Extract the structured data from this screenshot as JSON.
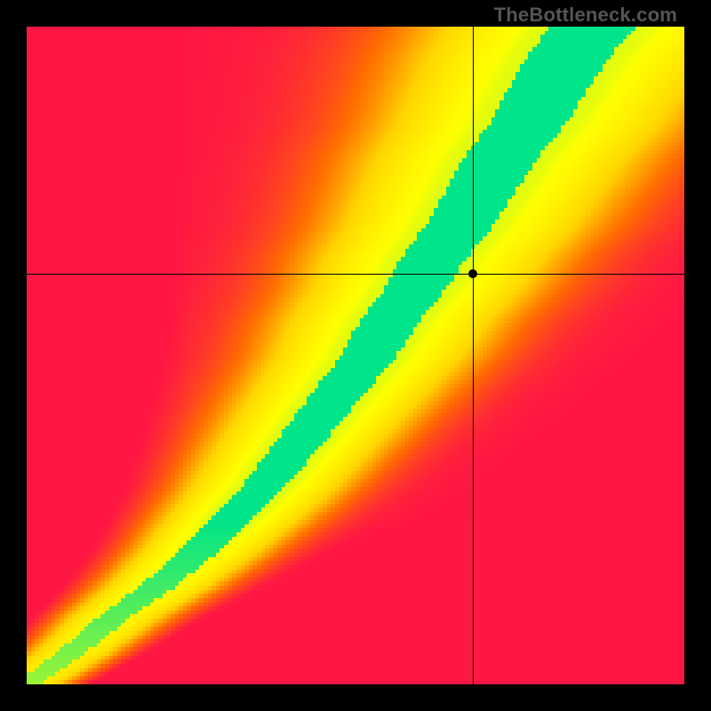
{
  "watermark": "TheBottleneck.com",
  "chart_data": {
    "type": "heatmap",
    "title": "",
    "xlabel": "",
    "ylabel": "",
    "xlim": [
      0,
      1
    ],
    "ylim": [
      0,
      1
    ],
    "grid": false,
    "legend": false,
    "crosshair": {
      "x": 0.678,
      "y": 0.625
    },
    "marker": {
      "x": 0.678,
      "y": 0.625
    },
    "green_ridge_x_for_y": [
      [
        0.0,
        0.0
      ],
      [
        0.05,
        0.07
      ],
      [
        0.1,
        0.13
      ],
      [
        0.15,
        0.2
      ],
      [
        0.2,
        0.26
      ],
      [
        0.25,
        0.31
      ],
      [
        0.3,
        0.36
      ],
      [
        0.35,
        0.4
      ],
      [
        0.4,
        0.44
      ],
      [
        0.45,
        0.48
      ],
      [
        0.5,
        0.52
      ],
      [
        0.55,
        0.55
      ],
      [
        0.6,
        0.59
      ],
      [
        0.65,
        0.62
      ],
      [
        0.7,
        0.66
      ],
      [
        0.75,
        0.69
      ],
      [
        0.8,
        0.72
      ],
      [
        0.85,
        0.76
      ],
      [
        0.9,
        0.79
      ],
      [
        0.95,
        0.82
      ],
      [
        1.0,
        0.86
      ]
    ],
    "colorscale": [
      [
        0.0,
        "#ff1744"
      ],
      [
        0.25,
        "#ff6d00"
      ],
      [
        0.5,
        "#ffd600"
      ],
      [
        0.75,
        "#ffff00"
      ],
      [
        1.0,
        "#00e589"
      ]
    ],
    "resolution": 160
  }
}
